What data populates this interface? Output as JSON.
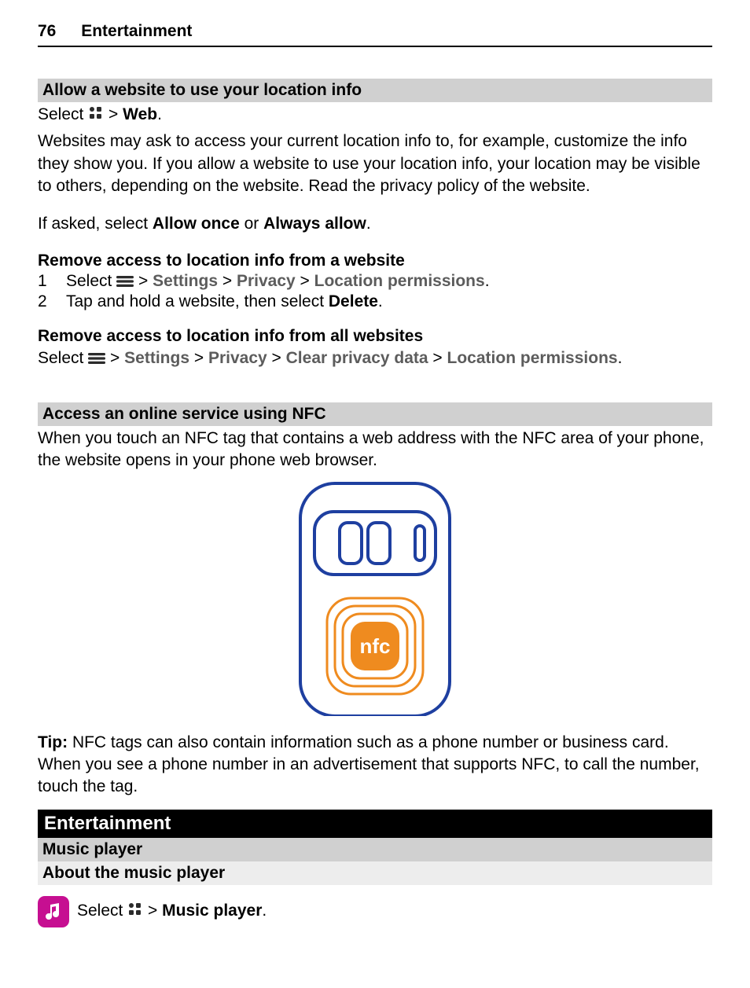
{
  "header": {
    "page_number": "76",
    "title": "Entertainment"
  },
  "s1": {
    "heading": "Allow a website to use your location info",
    "select_pre": "Select ",
    "select_post": " > ",
    "web": "Web",
    "period": ".",
    "p1": "Websites may ask to access your current location info to, for example, customize the info they show you. If you allow a website to use your location info, your location may be visible to others, depending on the website. Read the privacy policy of the website.",
    "p2_pre": "If asked, select ",
    "allow_once": "Allow once",
    "or": " or ",
    "always_allow": "Always allow",
    "sub1": "Remove access to location info from a website",
    "step1_num": "1",
    "step1_pre": "Select ",
    "gt": " > ",
    "settings": "Settings",
    "privacy": "Privacy",
    "loc_perm": "Location permissions",
    "step2_num": "2",
    "step2_text_a": "Tap and hold a website, then select ",
    "delete": "Delete",
    "sub2": "Remove access to location info from all websites",
    "clear_pd": "Clear privacy data"
  },
  "s2": {
    "heading": "Access an online service using NFC",
    "p1": "When you touch an NFC tag that contains a web address with the NFC area of your phone, the website opens in your phone web browser.",
    "nfc_label": "nfc",
    "tip_label": "Tip:",
    "tip_text": " NFC tags can also contain information such as a phone number or business card. When you see a phone number in an advertisement that supports NFC, to call the number, touch the tag."
  },
  "s3": {
    "chapter": "Entertainment",
    "sub1": "Music player",
    "sub2": "About the music player",
    "select_pre": "Select ",
    "gt": " > ",
    "music_player": "Music player",
    "period": "."
  }
}
